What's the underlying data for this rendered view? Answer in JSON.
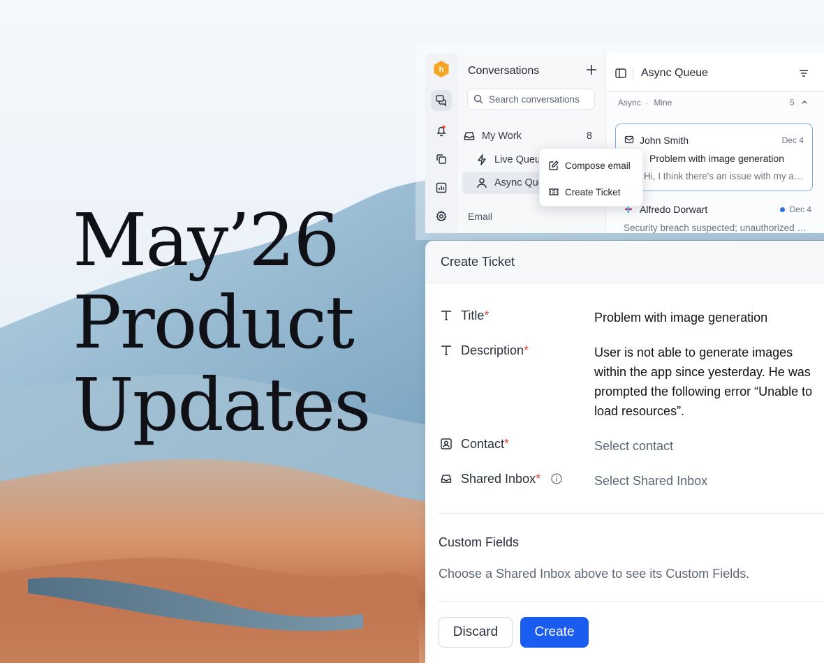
{
  "hero": {
    "line1": "May’26",
    "line2": "Product",
    "line3": "Updates"
  },
  "rail": {
    "icons": [
      "logo-icon",
      "chat-bubbles-icon",
      "bell-icon",
      "copy-icon",
      "chart-icon",
      "gear-icon"
    ],
    "logo_letter": "h",
    "brand_color": "#f5a524"
  },
  "conversations": {
    "title": "Conversations",
    "search_placeholder": "Search conversations",
    "items": [
      {
        "label": "My Work",
        "count": "8"
      },
      {
        "label": "Live Queue"
      },
      {
        "label": "Async Queue"
      }
    ],
    "section": "Email"
  },
  "menu": {
    "compose": "Compose email",
    "create_ticket": "Create Ticket"
  },
  "queue": {
    "title": "Async Queue",
    "filter_a": "Async",
    "filter_sep": "·",
    "filter_b": "Mine",
    "count": "5",
    "items": [
      {
        "name": "John Smith",
        "date": "Dec 4",
        "subject": "Problem with image generation",
        "preview": "Hi, I think there's an issue with my account"
      },
      {
        "name": "Alfredo Dorwart",
        "date": "Dec 4",
        "preview": "Security breach suspected; unauthorized access"
      }
    ],
    "unread_color": "#2f6fe8"
  },
  "ticket": {
    "title": "Create Ticket",
    "fields": {
      "title_label": "Title",
      "title_value": "Problem with image generation",
      "description_label": "Description",
      "description_lines": [
        "User is not able to generate images",
        "within the app since yesterday. He was",
        "prompted the following error “Unable to",
        "load resources”."
      ],
      "contact_label": "Contact",
      "contact_placeholder": "Select contact",
      "inbox_label": "Shared Inbox",
      "inbox_placeholder": "Select Shared Inbox"
    },
    "required_mark": "*",
    "custom_fields_title": "Custom Fields",
    "custom_fields_help": "Choose a Shared Inbox above to see its Custom Fields.",
    "discard": "Discard",
    "create": "Create",
    "primary_color": "#1a5cf0",
    "required_color": "#e5483b"
  }
}
